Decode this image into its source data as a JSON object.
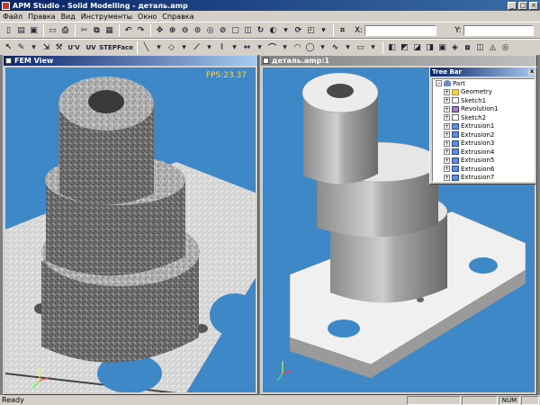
{
  "window": {
    "title": "APM Studio - Solid Modelling - деталь.amp"
  },
  "menu": {
    "items": [
      "Файл",
      "Правка",
      "Вид",
      "Инструменты",
      "Окно",
      "Справка"
    ]
  },
  "toolbar": {
    "x_label": "X:",
    "y_label": "Y:",
    "x_value": "",
    "y_value": "",
    "step_label": "STEP",
    "face_label": "Face"
  },
  "fem_view": {
    "title": "FEM View",
    "fps": "FPS:23.37"
  },
  "model_view": {
    "title": "деталь.amp:1"
  },
  "tree_bar": {
    "title": "Tree Bar",
    "close": "x",
    "items": [
      {
        "label": "Part",
        "icon": "part-icon",
        "level": 0
      },
      {
        "label": "Geometry",
        "icon": "folder-icon",
        "level": 1
      },
      {
        "label": "Sketch1",
        "icon": "sketch-icon",
        "level": 1
      },
      {
        "label": "Revolution1",
        "icon": "revolution-icon",
        "level": 1
      },
      {
        "label": "Sketch2",
        "icon": "sketch-icon",
        "level": 1
      },
      {
        "label": "Extrusion1",
        "icon": "extrusion-icon",
        "level": 1
      },
      {
        "label": "Extrusion2",
        "icon": "extrusion-icon",
        "level": 1
      },
      {
        "label": "Extrusion3",
        "icon": "extrusion-icon",
        "level": 1
      },
      {
        "label": "Extrusion4",
        "icon": "extrusion-icon",
        "level": 1
      },
      {
        "label": "Extrusion5",
        "icon": "extrusion-icon",
        "level": 1
      },
      {
        "label": "Extrusion6",
        "icon": "extrusion-icon",
        "level": 1
      },
      {
        "label": "Extrusion7",
        "icon": "extrusion-icon",
        "level": 1
      }
    ]
  },
  "status": {
    "ready": "Ready",
    "num": "NUM"
  },
  "colors": {
    "viewport_bg": "#3f88c8",
    "title_active": "#0a246a",
    "fps_text": "#ffd84a"
  }
}
